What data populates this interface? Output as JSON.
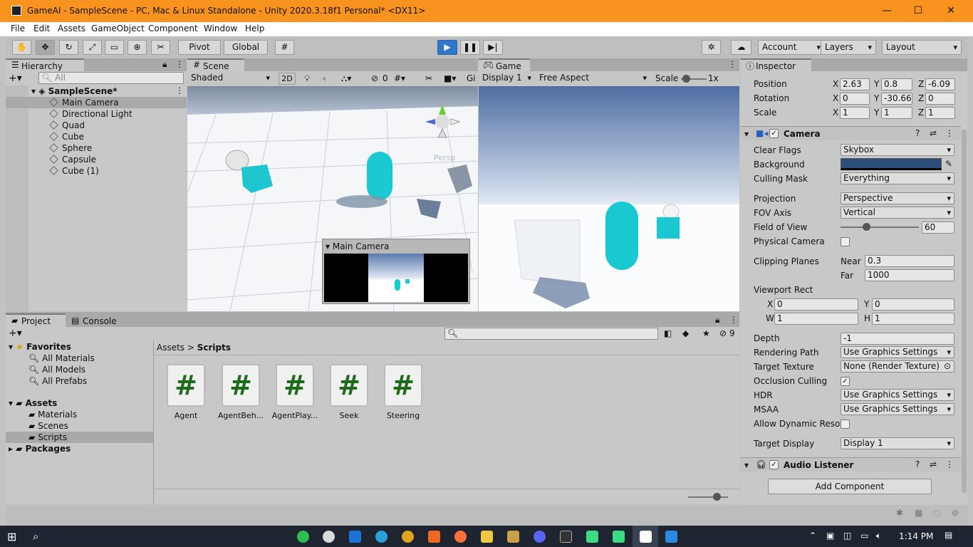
{
  "window": {
    "title": "GameAI - SampleScene - PC, Mac & Linux Standalone - Unity 2020.3.18f1 Personal* <DX11>"
  },
  "menu": [
    "File",
    "Edit",
    "Assets",
    "GameObject",
    "Component",
    "Window",
    "Help"
  ],
  "toolbar": {
    "pivot": "Pivot",
    "global": "Global",
    "account": "Account",
    "layers": "Layers",
    "layout": "Layout"
  },
  "hierarchy": {
    "tab": "Hierarchy",
    "search_placeholder": "All",
    "scene": "SampleScene*",
    "items": [
      "Main Camera",
      "Directional Light",
      "Quad",
      "Cube",
      "Sphere",
      "Capsule",
      "Cube (1)"
    ]
  },
  "scene": {
    "tab": "Scene",
    "shading": "Shaded",
    "mode_2d": "2D",
    "hidden_count": "0",
    "gizmos": "Gi",
    "persp": "Persp",
    "preview_title": "Main Camera"
  },
  "game": {
    "tab": "Game",
    "display": "Display 1",
    "aspect": "Free Aspect",
    "scale_label": "Scale",
    "scale_value": "1x"
  },
  "project": {
    "tab": "Project",
    "console_tab": "Console",
    "breadcrumb": [
      "Assets",
      "Scripts"
    ],
    "favorites": "Favorites",
    "fav_items": [
      "All Materials",
      "All Models",
      "All Prefabs"
    ],
    "assets": "Assets",
    "asset_folders": [
      "Materials",
      "Scenes",
      "Scripts"
    ],
    "packages": "Packages",
    "hidden_count": "9",
    "files": [
      "Agent",
      "AgentBeh...",
      "AgentPlay...",
      "Seek",
      "Steering"
    ],
    "file_glyph": "#"
  },
  "inspector": {
    "tab": "Inspector",
    "transform": {
      "position": "Position",
      "rotation": "Rotation",
      "scale": "Scale",
      "pos": [
        "2.63",
        "0.8",
        "-6.09"
      ],
      "rot": [
        "0",
        "-30.66",
        "0"
      ],
      "scl": [
        "1",
        "1",
        "1"
      ],
      "axes": [
        "X",
        "Y",
        "Z"
      ]
    },
    "camera": {
      "title": "Camera",
      "clear_flags_l": "Clear Flags",
      "clear_flags": "Skybox",
      "background_l": "Background",
      "background_color": "#2a4d7a",
      "culling_l": "Culling Mask",
      "culling": "Everything",
      "projection_l": "Projection",
      "projection": "Perspective",
      "fov_axis_l": "FOV Axis",
      "fov_axis": "Vertical",
      "fov_l": "Field of View",
      "fov": "60",
      "physical_l": "Physical Camera",
      "clip_l": "Clipping Planes",
      "near_l": "Near",
      "near": "0.3",
      "far_l": "Far",
      "far": "1000",
      "viewport_l": "Viewport Rect",
      "vx": "0",
      "vy": "0",
      "vw": "1",
      "vh": "1",
      "depth_l": "Depth",
      "depth": "-1",
      "render_path_l": "Rendering Path",
      "render_path": "Use Graphics Settings",
      "target_tex_l": "Target Texture",
      "target_tex": "None (Render Texture)",
      "occlusion_l": "Occlusion Culling",
      "hdr_l": "HDR",
      "hdr": "Use Graphics Settings",
      "msaa_l": "MSAA",
      "msaa": "Use Graphics Settings",
      "dynres_l": "Allow Dynamic Resol",
      "target_display_l": "Target Display",
      "target_display": "Display 1"
    },
    "audio_listener": "Audio Listener",
    "add_component": "Add Component"
  },
  "taskbar": {
    "time": "1:14 PM"
  }
}
